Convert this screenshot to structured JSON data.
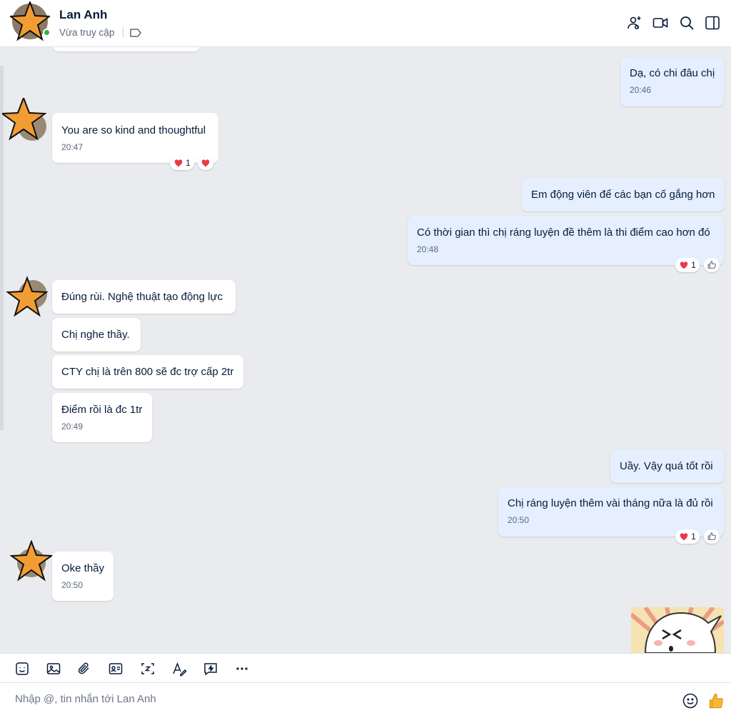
{
  "header": {
    "name": "Lan Anh",
    "status": "Vừa truy cập",
    "icons": [
      "add-friend-icon",
      "video-call-icon",
      "search-icon",
      "sidebar-toggle-icon",
      "tag-icon"
    ]
  },
  "messages": [
    {
      "dir": "out",
      "text": "Dạ, có chi đâu chị",
      "time": "20:46"
    },
    {
      "dir": "in",
      "text": "You are so kind and thoughtful",
      "time": "20:47",
      "reaction_count": "1"
    },
    {
      "dir": "out",
      "text": "Em động viên để các bạn cố gắng hơn"
    },
    {
      "dir": "out",
      "text": "Có thời gian thì chị ráng luyện đề thêm là thi điểm cao hơn đó",
      "time": "20:48",
      "reaction_count": "1"
    },
    {
      "dir": "in",
      "text": "Đúng rùi. Nghệ thuật tạo động lực"
    },
    {
      "dir": "in",
      "text": "Chị nghe thầy."
    },
    {
      "dir": "in",
      "text": "CTY chị là trên 800 sẽ đc trợ cấp 2tr"
    },
    {
      "dir": "in",
      "text": "Điểm rồi là đc 1tr",
      "time": "20:49"
    },
    {
      "dir": "out",
      "text": "Uầy. Vậy quá tốt rồi"
    },
    {
      "dir": "out",
      "text": "Chị ráng luyện thêm vài tháng nữa là đủ rồi",
      "time": "20:50",
      "reaction_count": "1"
    },
    {
      "dir": "in",
      "text": "Oke thầy",
      "time": "20:50"
    }
  ],
  "toolbar": {
    "icons": [
      "sticker-icon",
      "image-icon",
      "attachment-icon",
      "contact-card-icon",
      "screenshot-icon",
      "text-format-icon",
      "quick-message-icon",
      "more-icon"
    ]
  },
  "composer": {
    "placeholder": "Nhập @, tin nhắn tới Lan Anh"
  },
  "colors": {
    "accent": "#0068ff",
    "outgoing_bubble": "#e5efff",
    "incoming_bubble": "#ffffff",
    "background": "#e9ebee",
    "avatar_star": "#f39c34",
    "reaction_heart": "#e8394a"
  }
}
